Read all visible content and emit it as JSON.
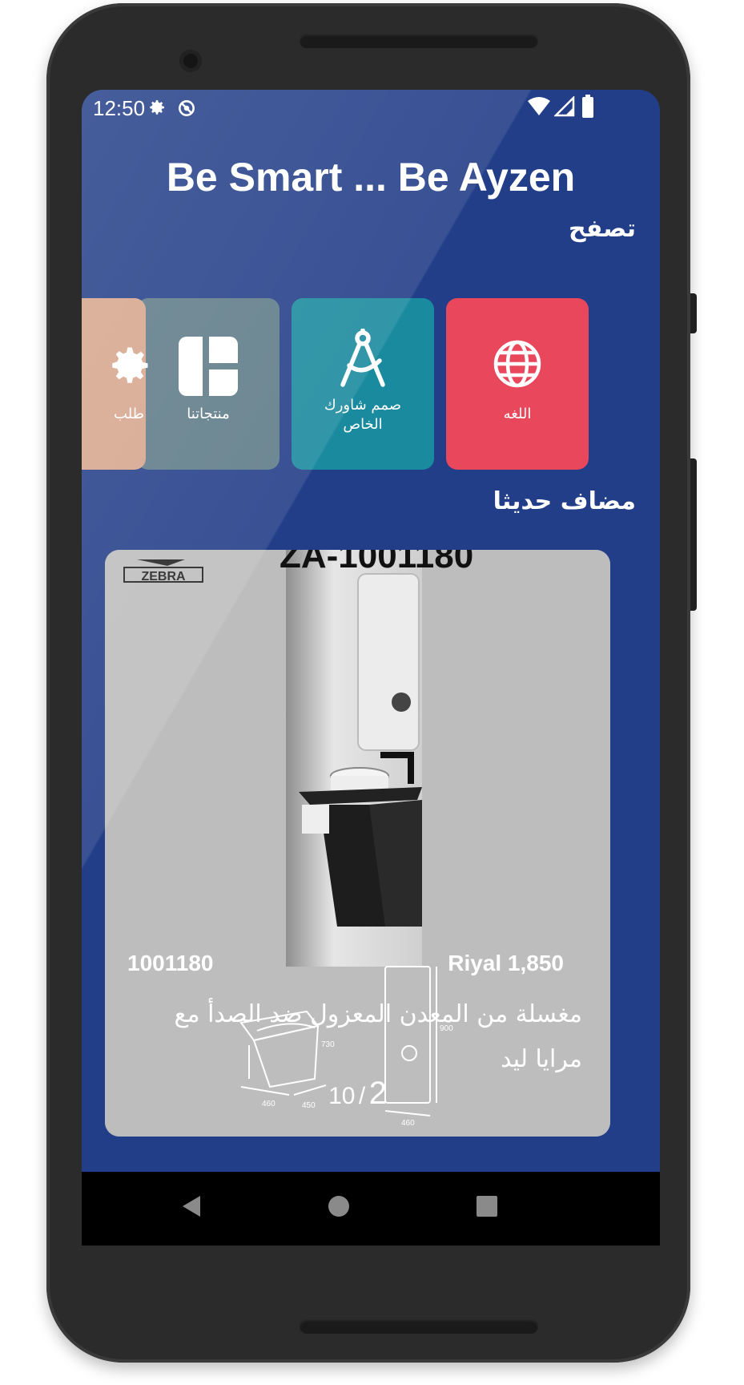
{
  "status_bar": {
    "time": "12:50",
    "icons": [
      "gear-icon",
      "sync-off-icon",
      "wifi-icon",
      "signal-icon",
      "battery-icon"
    ]
  },
  "header": {
    "title": "Be Smart ... Be Ayzen"
  },
  "browse": {
    "title": "تصفح",
    "items": [
      {
        "label": "اللغه",
        "icon": "globe-icon",
        "color": "#e8475c"
      },
      {
        "label": "صمم شاورك\nالخاص",
        "icon": "compass-icon",
        "color": "#1a8a9e"
      },
      {
        "label": "منتجاتنا",
        "icon": "layout-icon",
        "color": "#5d7a87"
      },
      {
        "label": "طلب",
        "icon": "gear-icon",
        "color": "#d6a58c"
      }
    ]
  },
  "recent": {
    "title": "مضاف حديثا",
    "product": {
      "brand_logo": "ZEBRA",
      "image_code": "ZA-1001180",
      "sku": "1001180",
      "price": "Riyal 1,850",
      "description": "مغسلة من المعدن المعزول ضد الصدأ مع مرايا ليد",
      "page_current": "2",
      "page_total": "10",
      "page_separator": "/"
    }
  },
  "nav": {
    "icons": [
      "back-icon",
      "home-icon",
      "recents-icon"
    ]
  },
  "colors": {
    "background": "#233e88",
    "card_bg": "#bdbdbd"
  }
}
